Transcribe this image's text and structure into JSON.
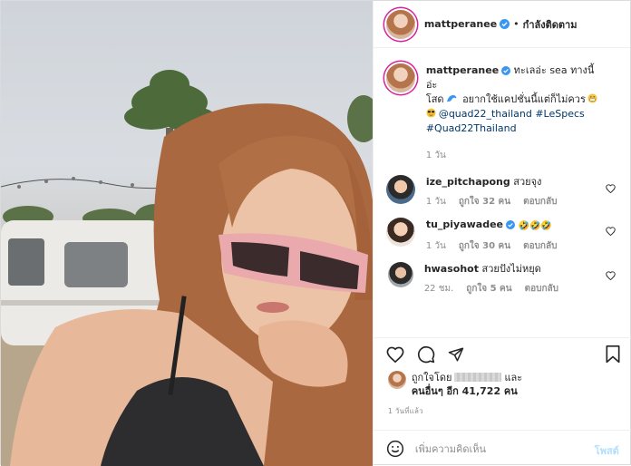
{
  "header": {
    "username": "mattperanee",
    "separator": "•",
    "follow_label": "กำลังติดตาม"
  },
  "caption": {
    "username": "mattperanee",
    "text_1": "ทะเลอ่ะ sea ทางนี้อ่ะ",
    "text_2": "โสด",
    "text_3": "อยากใช้แคปชั่นนี้แต่ก็ไม่ควร",
    "mention": "@quad22_thailand",
    "tag_1": "#LeSpecs",
    "tag_2": "#Quad22Thailand",
    "age": "1 วัน"
  },
  "comments": [
    {
      "username": "ize_pitchapong",
      "text": "สวยจุง",
      "age": "1 วัน",
      "likes": "ถูกใจ 32 คน",
      "reply": "ตอบกลับ"
    },
    {
      "username": "tu_piyawadee",
      "text": "🤣🤣🤣",
      "age": "1 วัน",
      "likes": "ถูกใจ 30 คน",
      "reply": "ตอบกลับ"
    },
    {
      "username": "hwasohot",
      "text": "สวยปังไม่หยุด",
      "age": "22 ชม.",
      "likes": "ถูกใจ 5 คน",
      "reply": "ตอบกลับ"
    }
  ],
  "likes": {
    "prefix": "ถูกใจโดย",
    "suffix": "และ",
    "others": "คนอื่นๆ อีก 41,722 คน"
  },
  "timestamp": "1 วันที่แล้ว",
  "add_comment": {
    "placeholder": "เพิ่มความคิดเห็น",
    "post_label": "โพสต์"
  },
  "colors": {
    "verified": "#3897f0",
    "link": "#00376b",
    "muted": "#8e8e8e",
    "post_disabled": "#b2dffc"
  }
}
